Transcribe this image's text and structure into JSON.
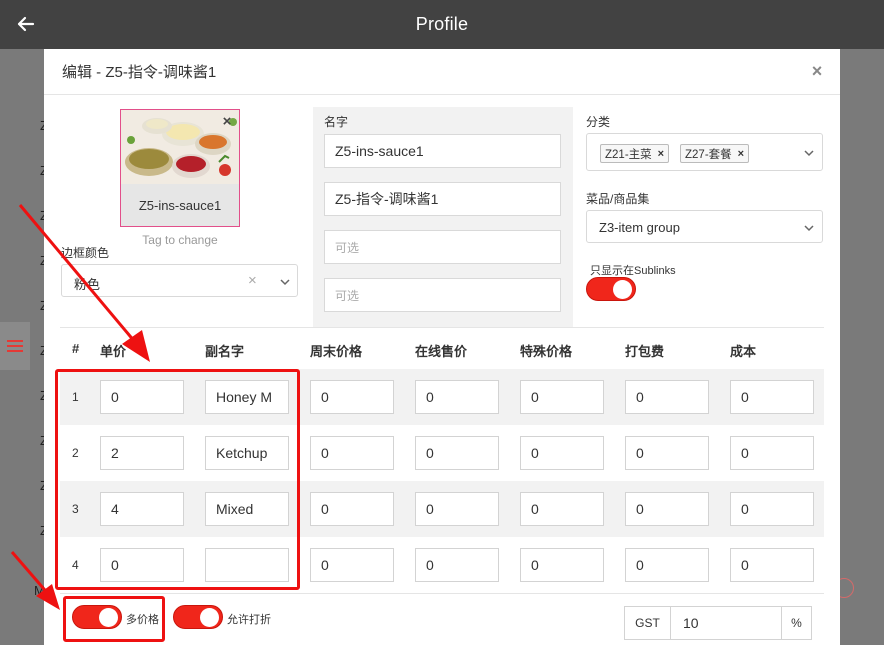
{
  "header": {
    "title": "Profile"
  },
  "background": {
    "row_letters": [
      "Z",
      "Z",
      "Z",
      "Z",
      "Z",
      "Z",
      "Z",
      "Z",
      "Z",
      "Z",
      "Z"
    ],
    "partial_text": "M"
  },
  "modal": {
    "title": "编辑 - Z5-指令-调味酱1",
    "close_symbol": "×"
  },
  "image": {
    "caption": "Z5-ins-sauce1",
    "hint": "Tag to change",
    "remove_symbol": "×"
  },
  "border_color": {
    "label": "边框颜色",
    "value": "粉色"
  },
  "name": {
    "label": "名字",
    "value_1": "Z5-ins-sauce1",
    "value_2": "Z5-指令-调味酱1",
    "optional_placeholder_1": "可选",
    "optional_placeholder_2": "可选"
  },
  "category": {
    "label": "分类",
    "chips": [
      "Z21-主菜",
      "Z27-套餐"
    ],
    "chip_remove": "×"
  },
  "item_group": {
    "label": "菜品/商品集",
    "value": "Z3-item group"
  },
  "sublinks": {
    "label": "只显示在Sublinks",
    "on": true
  },
  "table": {
    "headers": [
      "#",
      "单价",
      "副名字",
      "周末价格",
      "在线售价",
      "特殊价格",
      "打包费",
      "成本"
    ],
    "rows": [
      {
        "num": "1",
        "price": "0",
        "subname": "Honey M",
        "weekend": "0",
        "online": "0",
        "special": "0",
        "packing": "0",
        "cost": "0"
      },
      {
        "num": "2",
        "price": "2",
        "subname": "Ketchup",
        "weekend": "0",
        "online": "0",
        "special": "0",
        "packing": "0",
        "cost": "0"
      },
      {
        "num": "3",
        "price": "4",
        "subname": "Mixed",
        "weekend": "0",
        "online": "0",
        "special": "0",
        "packing": "0",
        "cost": "0"
      },
      {
        "num": "4",
        "price": "0",
        "subname": "",
        "weekend": "0",
        "online": "0",
        "special": "0",
        "packing": "0",
        "cost": "0"
      }
    ]
  },
  "footer": {
    "multi_price": {
      "label": "多价格",
      "on": true
    },
    "allow_discount": {
      "label": "允许打折",
      "on": true
    },
    "gst": {
      "label": "GST",
      "value": "10",
      "unit": "%"
    }
  },
  "colors": {
    "accent_red": "#f0261b",
    "annotation_red": "#ee1111",
    "header_bg": "#424242",
    "highlight_border": "#e24f8a"
  }
}
